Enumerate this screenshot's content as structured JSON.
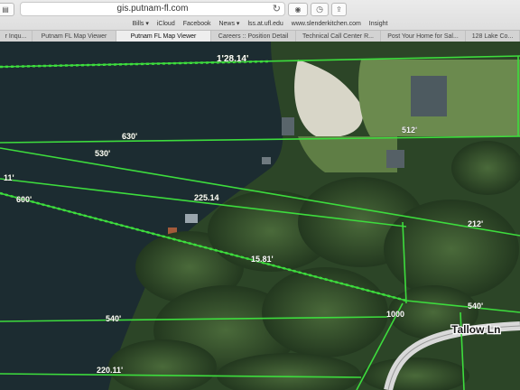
{
  "browser": {
    "url": "gis.putnam-fl.com",
    "favorites": [
      "Bills ▾",
      "iCloud",
      "Facebook",
      "News ▾",
      "lss.at.ufl.edu",
      "www.slenderkitchen.com",
      "Insight"
    ],
    "tabs": [
      {
        "label": "r Inqu..."
      },
      {
        "label": "Putnam FL Map Viewer"
      },
      {
        "label": "Putnam FL Map Viewer",
        "active": true
      },
      {
        "label": "Careers :: Position Detail"
      },
      {
        "label": "Technical Call Center R..."
      },
      {
        "label": "Post Your Home for Sal..."
      },
      {
        "label": "128 Lake Co..."
      }
    ]
  },
  "map": {
    "road_label": "Tallow Ln",
    "parcel_labels": [
      "1'28.14'",
      "630'",
      "11'",
      "530'",
      "600'",
      "225.14",
      "212'",
      "540'",
      "540'",
      "220.11'",
      "15.81'",
      "1000",
      "512'"
    ],
    "colors": {
      "parcel_line": "#3ddc3d",
      "water": "#1c2c31",
      "tree": "#2f4a2a"
    }
  }
}
